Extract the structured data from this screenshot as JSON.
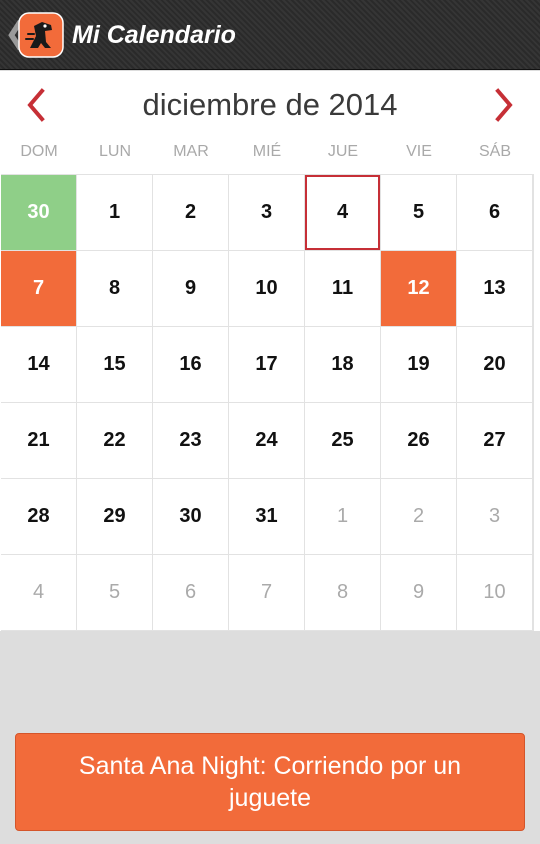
{
  "header": {
    "back_glyph": "❮",
    "app_title": "Mi Calendario",
    "logo_icon": "dog-app-logo-icon"
  },
  "calendar": {
    "month_title": "diciembre de 2014",
    "prev_icon": "chevron-left-icon",
    "next_icon": "chevron-right-icon",
    "accent_color": "#c62f36",
    "weekdays": [
      "DOM",
      "LUN",
      "MAR",
      "MIÉ",
      "JUE",
      "VIE",
      "SÁB"
    ],
    "days": [
      {
        "label": "30",
        "state": "today"
      },
      {
        "label": "1",
        "state": "current"
      },
      {
        "label": "2",
        "state": "current"
      },
      {
        "label": "3",
        "state": "current"
      },
      {
        "label": "4",
        "state": "selected"
      },
      {
        "label": "5",
        "state": "current"
      },
      {
        "label": "6",
        "state": "current"
      },
      {
        "label": "7",
        "state": "event"
      },
      {
        "label": "8",
        "state": "current"
      },
      {
        "label": "9",
        "state": "current"
      },
      {
        "label": "10",
        "state": "current"
      },
      {
        "label": "11",
        "state": "current"
      },
      {
        "label": "12",
        "state": "event"
      },
      {
        "label": "13",
        "state": "current"
      },
      {
        "label": "14",
        "state": "current"
      },
      {
        "label": "15",
        "state": "current"
      },
      {
        "label": "16",
        "state": "current"
      },
      {
        "label": "17",
        "state": "current"
      },
      {
        "label": "18",
        "state": "current"
      },
      {
        "label": "19",
        "state": "current"
      },
      {
        "label": "20",
        "state": "current"
      },
      {
        "label": "21",
        "state": "current"
      },
      {
        "label": "22",
        "state": "current"
      },
      {
        "label": "23",
        "state": "current"
      },
      {
        "label": "24",
        "state": "current"
      },
      {
        "label": "25",
        "state": "current"
      },
      {
        "label": "26",
        "state": "current"
      },
      {
        "label": "27",
        "state": "current"
      },
      {
        "label": "28",
        "state": "current"
      },
      {
        "label": "29",
        "state": "current"
      },
      {
        "label": "30",
        "state": "current"
      },
      {
        "label": "31",
        "state": "current"
      },
      {
        "label": "1",
        "state": "other"
      },
      {
        "label": "2",
        "state": "other"
      },
      {
        "label": "3",
        "state": "other"
      },
      {
        "label": "4",
        "state": "other"
      },
      {
        "label": "5",
        "state": "other"
      },
      {
        "label": "6",
        "state": "other"
      },
      {
        "label": "7",
        "state": "other"
      },
      {
        "label": "8",
        "state": "other"
      },
      {
        "label": "9",
        "state": "other"
      },
      {
        "label": "10",
        "state": "other"
      }
    ]
  },
  "colors": {
    "today": "#8fcf88",
    "event": "#f26b3a",
    "selected_border": "#c62f36"
  },
  "event": {
    "title": "Santa Ana Night: Corriendo por un juguete"
  }
}
